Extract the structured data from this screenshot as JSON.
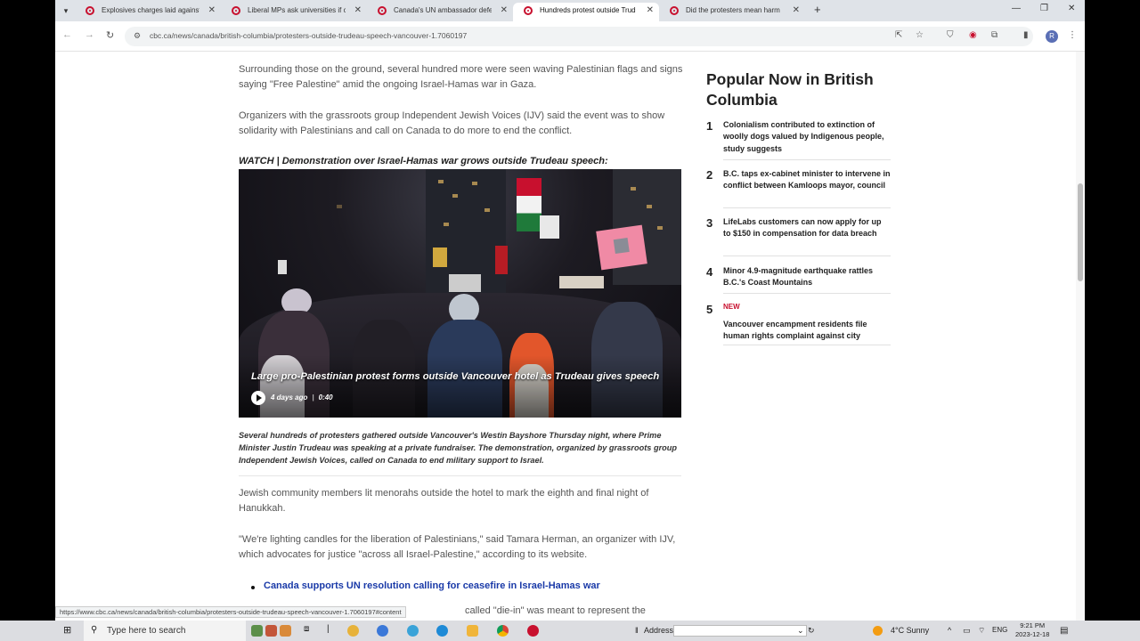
{
  "browser": {
    "tabs": [
      {
        "title": "Explosives charges laid against",
        "active": false
      },
      {
        "title": "Liberal MPs ask universities if c",
        "active": false
      },
      {
        "title": "Canada's UN ambassador defe",
        "active": false
      },
      {
        "title": "Hundreds protest outside Trud",
        "active": true
      },
      {
        "title": "Did the protesters mean harm",
        "active": false
      }
    ],
    "url": "cbc.ca/news/canada/british-columbia/protesters-outside-trudeau-speech-vancouver-1.7060197",
    "profile_initial": "R",
    "status_url": "https://www.cbc.ca/news/canada/british-columbia/protesters-outside-trudeau-speech-vancouver-1.7060197#content"
  },
  "article": {
    "para1": "Surrounding those on the ground, several hundred more were seen waving Palestinian flags and signs saying \"Free Palestine\" amid the ongoing Israel-Hamas war in Gaza.",
    "para2": "Organizers with the grassroots group Independent Jewish Voices (IJV) said the event was to show solidarity with Palestinians and call on Canada to do more to end the conflict.",
    "watch_label": "WATCH | Demonstration over Israel-Hamas war grows outside Trudeau speech:",
    "video": {
      "title": "Large pro-Palestinian protest forms outside Vancouver hotel as Trudeau gives speech",
      "age": "4 days ago",
      "duration": "0:40"
    },
    "caption": "Several hundreds of protesters gathered outside Vancouver's Westin Bayshore Thursday night, where Prime Minister Justin Trudeau was speaking at a private fundraiser. The demonstration, organized by grassroots group Independent Jewish Voices, called on Canada to end military support to Israel.",
    "para3": "Jewish community members lit menorahs outside the hotel to mark the eighth and final night of Hanukkah.",
    "para4": "\"We're lighting candles for the liberation of Palestinians,\" said Tamara Herman, an organizer with IJV, which advocates for justice \"across all Israel-Palestine,\" according to its website.",
    "related_link": "Canada supports UN resolution calling for ceasefire in Israel-Hamas war",
    "cut_para": "called \"die-in\" was meant to represent the"
  },
  "sidebar": {
    "title": "Popular Now in British Columbia",
    "items": [
      {
        "rank": "1",
        "badge": "",
        "text": "Colonialism contributed to extinction of woolly dogs valued by Indigenous people, study suggests"
      },
      {
        "rank": "2",
        "badge": "",
        "text": "B.C. taps ex-cabinet minister to intervene in conflict between Kamloops mayor, council"
      },
      {
        "rank": "3",
        "badge": "",
        "text": "LifeLabs customers can now apply for up to $150 in compensation for data breach"
      },
      {
        "rank": "4",
        "badge": "",
        "text": "Minor 4.9-magnitude earthquake rattles B.C.'s Coast Mountains"
      },
      {
        "rank": "5",
        "badge": "NEW",
        "text": "Vancouver encampment residents file human rights complaint against city"
      }
    ]
  },
  "taskbar": {
    "search_placeholder": "Type here to search",
    "address_label": "Address",
    "weather": "4°C  Sunny",
    "lang": "ENG",
    "time": "9:21 PM",
    "date": "2023-12-18"
  },
  "colors": {
    "cbc_red": "#c8102e",
    "link_blue": "#1a3aa8"
  }
}
